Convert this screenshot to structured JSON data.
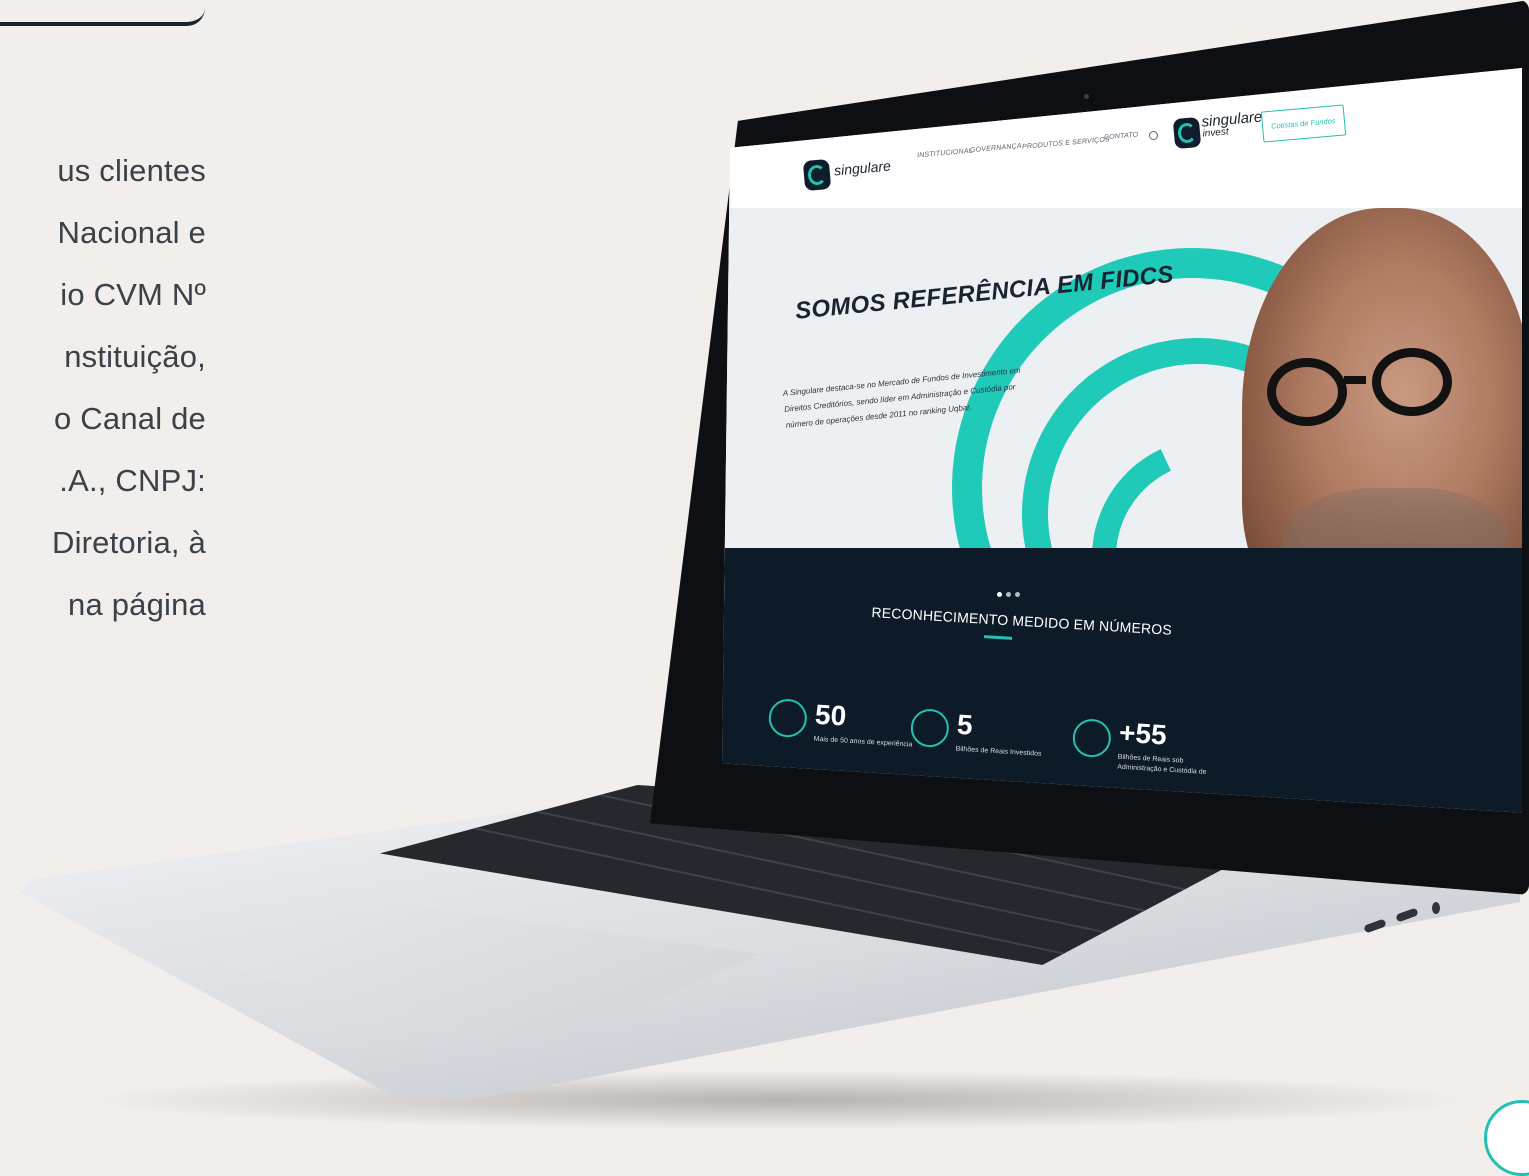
{
  "left_text": {
    "lines": [
      "us  clientes",
      "Nacional e",
      "io CVM Nº",
      "nstituição,",
      "o Canal de",
      ".A.,  CNPJ:",
      "Diretoria, à",
      "na  página"
    ]
  },
  "website": {
    "header": {
      "logo_text": "singulare",
      "nav_items": [
        "INSTITUCIONAL",
        "GOVERNANÇA",
        "PRODUTOS E SERVIÇOS",
        "CONTATO"
      ],
      "invest_logo_text": "singulare",
      "invest_logo_sub": "invest",
      "cotistas_button": "Cotistas de Fundos"
    },
    "hero": {
      "title": "SOMOS REFERÊNCIA EM FIDCS",
      "description": "A Singulare destaca-se no Mercado de Fundos de Investimento em Direitos Creditórios, sendo líder em Administração e Custódia por número de operações desde 2011 no ranking Uqbar.",
      "slider_dots": 3,
      "active_dot": 0
    },
    "numbers": {
      "title": "RECONHECIMENTO MEDIDO EM NÚMEROS",
      "stats": [
        {
          "value": "50",
          "label": "Mais de 50 anos de experiência",
          "icon": "people-stars-icon"
        },
        {
          "value": "5",
          "label": "Bilhões de Reais Investidos",
          "icon": "coins-growth-icon"
        },
        {
          "value": "+55",
          "label": "Bilhões de Reais sob Administração e Custódia de",
          "icon": "money-hand-icon"
        }
      ]
    }
  },
  "colors": {
    "accent": "#23c1b2",
    "dark_band": "#0d1b28",
    "background": "#f2eeeb"
  }
}
